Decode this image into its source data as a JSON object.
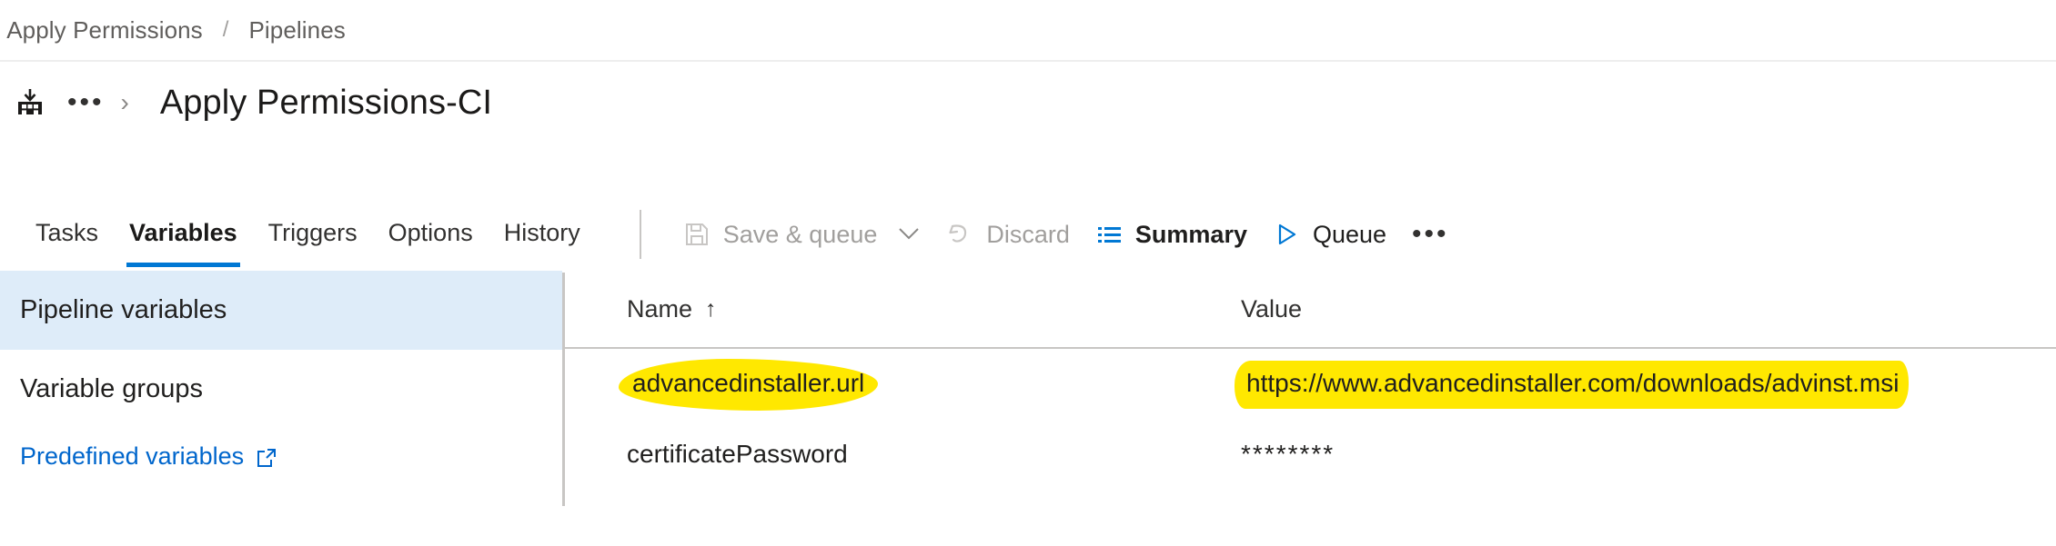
{
  "breadcrumb": {
    "lead_separator": "/",
    "items": [
      "Apply Permissions",
      "Pipelines"
    ],
    "separator": "/"
  },
  "title_row": {
    "build_icon": "build-icon",
    "overflow": "•••",
    "chevron": "›",
    "title": "Apply Permissions-CI"
  },
  "tabs": [
    {
      "label": "Tasks",
      "active": false
    },
    {
      "label": "Variables",
      "active": true
    },
    {
      "label": "Triggers",
      "active": false
    },
    {
      "label": "Options",
      "active": false
    },
    {
      "label": "History",
      "active": false
    }
  ],
  "toolbar": {
    "save_queue_label": "Save & queue",
    "save_queue_chevron": "⌵",
    "discard_label": "Discard",
    "summary_label": "Summary",
    "queue_label": "Queue",
    "more_label": "•••"
  },
  "sidebar": {
    "items": [
      {
        "label": "Pipeline variables",
        "selected": true
      },
      {
        "label": "Variable groups",
        "selected": false
      }
    ],
    "link": {
      "label": "Predefined variables",
      "icon": "external-link-icon"
    }
  },
  "table": {
    "columns": {
      "name": "Name",
      "sort_indicator": "↑",
      "value": "Value"
    },
    "rows": [
      {
        "name": "advancedinstaller.url",
        "value": "https://www.advancedinstaller.com/downloads/advinst.msi",
        "name_highlighted": true,
        "value_highlighted": true,
        "masked": false
      },
      {
        "name": "certificatePassword",
        "value": "********",
        "name_highlighted": false,
        "value_highlighted": false,
        "masked": true
      }
    ]
  },
  "colors": {
    "accent": "#0078d4",
    "link": "#0066cc",
    "selected_row_bg": "#deecf9",
    "highlighter": "#ffe800",
    "disabled_text": "#a19f9d",
    "divider": "#c8c6c4"
  }
}
